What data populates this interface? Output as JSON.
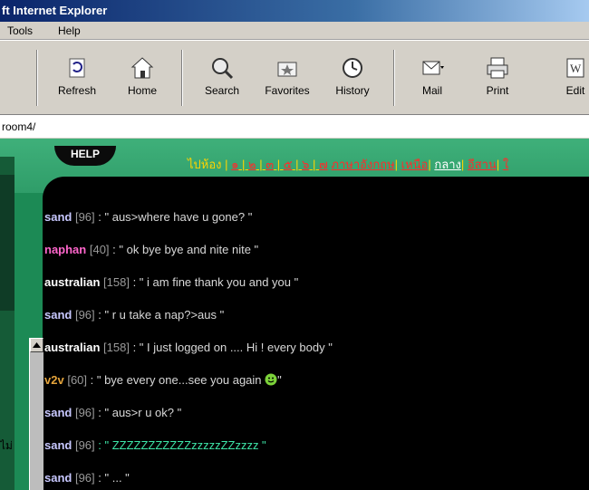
{
  "window": {
    "title": "ft Internet Explorer"
  },
  "menu": {
    "items": [
      "Tools",
      "Help"
    ]
  },
  "toolbar": {
    "buttons": [
      {
        "label": "p"
      },
      {
        "label": "Refresh"
      },
      {
        "label": "Home"
      },
      {
        "label": "Search"
      },
      {
        "label": "Favorites"
      },
      {
        "label": "History"
      },
      {
        "label": "Mail"
      },
      {
        "label": "Print"
      },
      {
        "label": "Edit"
      }
    ]
  },
  "address": {
    "text": "room4/"
  },
  "content": {
    "help_label": "HELP",
    "nav": {
      "prefix": "ไปห้อง",
      "links": [
        "๑",
        "๒",
        "๓",
        "๕",
        "๖",
        "๗",
        "ภาษาอังกฤษ",
        "เหนือ",
        "กลาง",
        "อีสาน",
        "ใ"
      ]
    },
    "messages": [
      {
        "name": "sand",
        "id": "[96]",
        "text": " : \" aus>where have u gone?    \"",
        "name_color": "#c8c8ff"
      },
      {
        "name": "naphan",
        "id": "[40]",
        "text": " : \" ok bye bye and nite nite     \"",
        "name_color": "#ff66cc"
      },
      {
        "name": "australian",
        "id": "[158]",
        "text": " : \" i am fine thank you and you     \"",
        "name_color": "#ffffff"
      },
      {
        "name": "sand",
        "id": "[96]",
        "text": " : \" r u take a nap?>aus     \"",
        "name_color": "#c8c8ff"
      },
      {
        "name": "australian",
        "id": "[158]",
        "text": " : \" I just logged on .... Hi ! every body     \"",
        "name_color": "#ffffff"
      },
      {
        "name": "v2v",
        "id": "[60]",
        "text": " : \" bye every one...see you again ",
        "name_color": "#e3a33b",
        "emoticon": true
      },
      {
        "name": "sand",
        "id": "[96]",
        "text": " : \" aus>r u ok?     \"",
        "name_color": "#c8c8ff"
      },
      {
        "name": "sand",
        "id": "[96]",
        "text": " : \" ZZZZZZZZZZZzzzzzZZzzzz     \"",
        "name_color": "#c8c8ff",
        "msg_color": "#3ee6a8"
      },
      {
        "name": "sand",
        "id": "[96]",
        "text": " : \" ...     \"",
        "name_color": "#c8c8ff"
      }
    ],
    "bottom_left": "ไม่"
  }
}
